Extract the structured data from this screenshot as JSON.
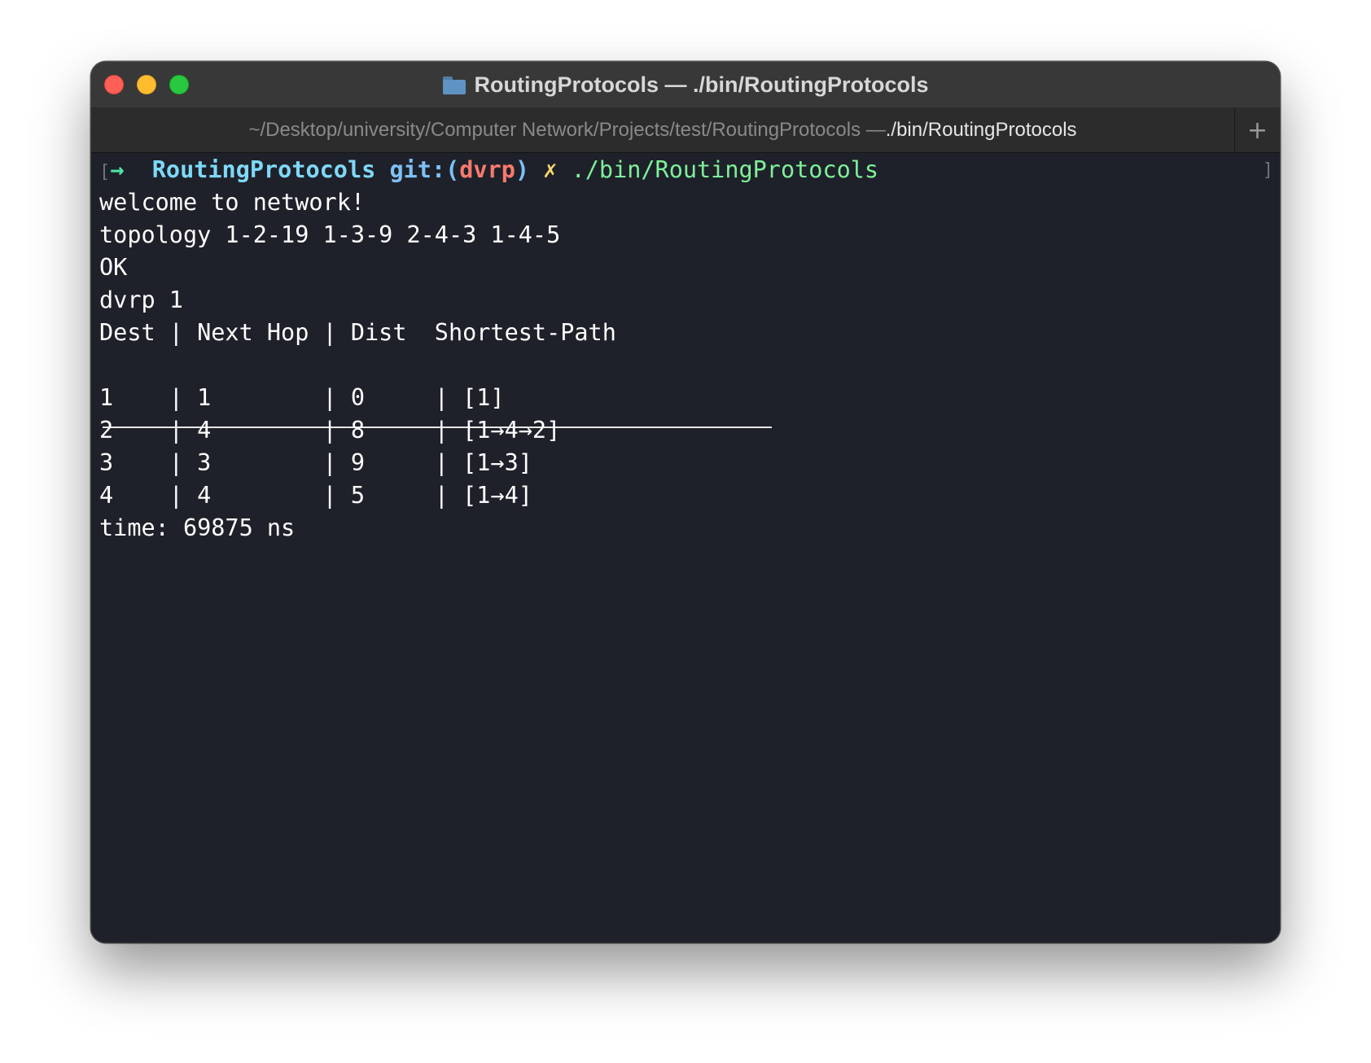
{
  "window": {
    "title": "RoutingProtocols — ./bin/RoutingProtocols",
    "folder_icon": "folder-icon"
  },
  "tab": {
    "path_prefix": "~/Desktop/university/Computer Network/Projects/test/RoutingProtocols — ",
    "path_command": "./bin/RoutingProtocols",
    "new_tab_label": "+"
  },
  "terminal": {
    "prompt": {
      "arrow": "→",
      "dir": "RoutingProtocols",
      "git_prefix": "git:(",
      "branch": "dvrp",
      "git_suffix": ")",
      "dirty": "✗",
      "command": "./bin/RoutingProtocols"
    },
    "lines": [
      "welcome to network!",
      "topology 1-2-19 1-3-9 2-4-3 1-4-5",
      "OK",
      "dvrp 1",
      "Dest | Next Hop | Dist  Shortest-Path"
    ],
    "table_rows": [
      "1    | 1        | 0     | [1]",
      "2    | 4        | 8     | [1→4→2]",
      "3    | 3        | 9     | [1→3]",
      "4    | 4        | 5     | [1→4]"
    ],
    "time_line": "time: 69875 ns"
  }
}
